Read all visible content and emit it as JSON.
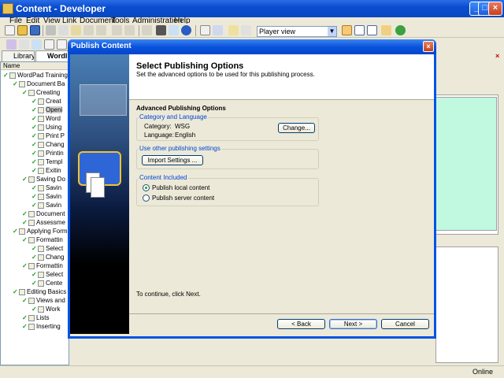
{
  "app": {
    "title": "Content - Developer",
    "menu": [
      "File",
      "Edit",
      "View",
      "Link",
      "Document",
      "Tools",
      "Administration",
      "Help"
    ],
    "view_select": "Player view",
    "status": "Online"
  },
  "tabs": [
    {
      "label": "Library"
    },
    {
      "label": "WordI"
    }
  ],
  "tree": {
    "header": "Name",
    "nodes": [
      {
        "label": "WordPad Training",
        "depth": 0
      },
      {
        "label": "Document Ba",
        "depth": 1
      },
      {
        "label": "Creating",
        "depth": 2
      },
      {
        "label": "Creat",
        "depth": 3
      },
      {
        "label": "Openi",
        "depth": 3
      },
      {
        "label": "Word",
        "depth": 3
      },
      {
        "label": "Using",
        "depth": 3
      },
      {
        "label": "Print P",
        "depth": 3
      },
      {
        "label": "Chang",
        "depth": 3
      },
      {
        "label": "Printin",
        "depth": 3
      },
      {
        "label": "Templ",
        "depth": 3
      },
      {
        "label": "Exitin",
        "depth": 3
      },
      {
        "label": "Saving Do",
        "depth": 2
      },
      {
        "label": "Savin",
        "depth": 3
      },
      {
        "label": "Savin",
        "depth": 3
      },
      {
        "label": "Savin",
        "depth": 3
      },
      {
        "label": "Document",
        "depth": 2
      },
      {
        "label": "Assessme",
        "depth": 2
      },
      {
        "label": "Applying Form",
        "depth": 1
      },
      {
        "label": "Formattin",
        "depth": 2
      },
      {
        "label": "Select",
        "depth": 3
      },
      {
        "label": "Chang",
        "depth": 3
      },
      {
        "label": "Formattin",
        "depth": 2
      },
      {
        "label": "Select",
        "depth": 3
      },
      {
        "label": "Cente",
        "depth": 3
      },
      {
        "label": "Editing Basics",
        "depth": 1
      },
      {
        "label": "Views and",
        "depth": 2
      },
      {
        "label": "Work",
        "depth": 3
      },
      {
        "label": "Lists",
        "depth": 2
      },
      {
        "label": "Inserting",
        "depth": 2
      }
    ]
  },
  "dialog": {
    "title": "Publish Content",
    "heading": "Select Publishing Options",
    "subheading": "Set the advanced options to be used for this publishing process.",
    "section_title": "Advanced Publishing Options",
    "group_category": {
      "label": "Category and Language",
      "category_label": "Category:",
      "category_value": "WSG",
      "language_label": "Language:",
      "language_value": "English",
      "change_button": "Change..."
    },
    "group_settings": {
      "label": "Use other publishing settings",
      "import_button": "Import Settings ..."
    },
    "group_content": {
      "label": "Content Included",
      "options": [
        {
          "label": "Publish local content",
          "selected": true
        },
        {
          "label": "Publish server content",
          "selected": false
        }
      ]
    },
    "continue_text": "To continue, click Next.",
    "buttons": {
      "back": "< Back",
      "next": "Next >",
      "cancel": "Cancel"
    }
  }
}
